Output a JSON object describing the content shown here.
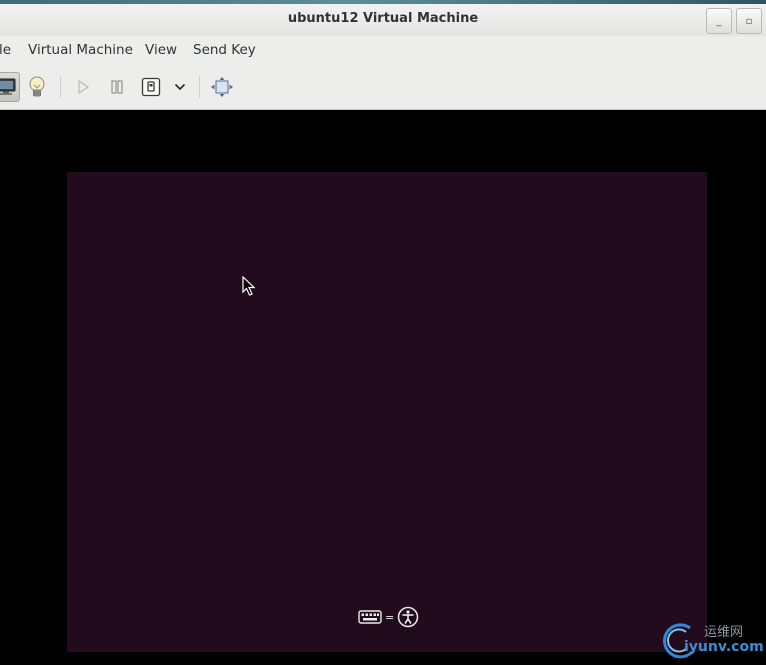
{
  "window": {
    "title": "ubuntu12 Virtual Machine",
    "minimize_glyph": "_",
    "maximize_glyph": "▫"
  },
  "menu": {
    "items": [
      {
        "label": "le"
      },
      {
        "label": "Virtual Machine"
      },
      {
        "label": "View"
      },
      {
        "label": "Send Key"
      }
    ]
  },
  "toolbar": {
    "buttons": [
      {
        "name": "console",
        "icon": "monitor-icon",
        "active": true
      },
      {
        "name": "details",
        "icon": "lightbulb-icon"
      },
      {
        "name": "run",
        "icon": "play-icon",
        "enabled": false
      },
      {
        "name": "pause",
        "icon": "pause-icon"
      },
      {
        "name": "shutdown",
        "icon": "power-button-icon"
      },
      {
        "name": "shutdown-menu",
        "icon": "chevron-down-icon"
      },
      {
        "name": "fullscreen",
        "icon": "fullscreen-arrows-icon"
      }
    ]
  },
  "guest": {
    "background_color": "#220b1c",
    "indicators": [
      "keyboard-icon",
      "accessibility-icon"
    ],
    "indicator_separator": "="
  },
  "watermark": {
    "cn_text": "运维网",
    "url_text": "iyunv.com"
  }
}
